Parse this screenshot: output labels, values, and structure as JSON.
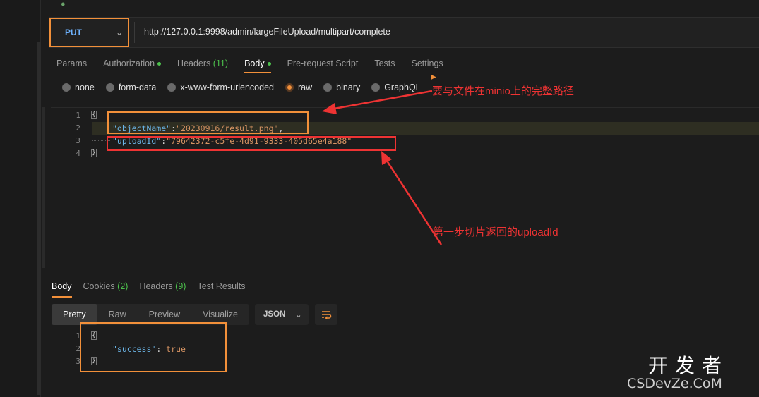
{
  "request": {
    "method": "PUT",
    "url": "http://127.0.0.1:9998/admin/largeFileUpload/multipart/complete"
  },
  "tabs": [
    {
      "label": "Params"
    },
    {
      "label": "Authorization"
    },
    {
      "label": "Headers",
      "count": "(11)"
    },
    {
      "label": "Body"
    },
    {
      "label": "Pre-request Script"
    },
    {
      "label": "Tests"
    },
    {
      "label": "Settings"
    }
  ],
  "body_types": [
    "none",
    "form-data",
    "x-www-form-urlencoded",
    "raw",
    "binary",
    "GraphQL"
  ],
  "selected_body_type": "raw",
  "request_body": {
    "line_numbers": [
      "1",
      "2",
      "3",
      "4"
    ],
    "key1": "\"objectName\"",
    "val1": "\"20230916/result.png\"",
    "key2": "\"uploadId\"",
    "val2": "\"79642372-c5fe-4d91-9333-405d65e4a188\""
  },
  "response": {
    "tabs": [
      {
        "label": "Body"
      },
      {
        "label": "Cookies",
        "count": "(2)"
      },
      {
        "label": "Headers",
        "count": "(9)"
      },
      {
        "label": "Test Results"
      }
    ],
    "view_modes": [
      "Pretty",
      "Raw",
      "Preview",
      "Visualize"
    ],
    "format": "JSON",
    "line_numbers": [
      "1",
      "2",
      "3"
    ],
    "key": "\"success\"",
    "value": "true"
  },
  "annotations": {
    "object_name_note": "要与文件在minio上的完整路径",
    "upload_id_note": "第一步切片返回的uploadId"
  },
  "watermark": {
    "main": "开发者",
    "sub": "CSDevZe.CoM"
  },
  "colors": {
    "accent": "#f2903a",
    "annotation": "#ee3333",
    "json_key": "#6cb6e8",
    "json_string": "#d79463",
    "method": "#6eb3ff"
  }
}
